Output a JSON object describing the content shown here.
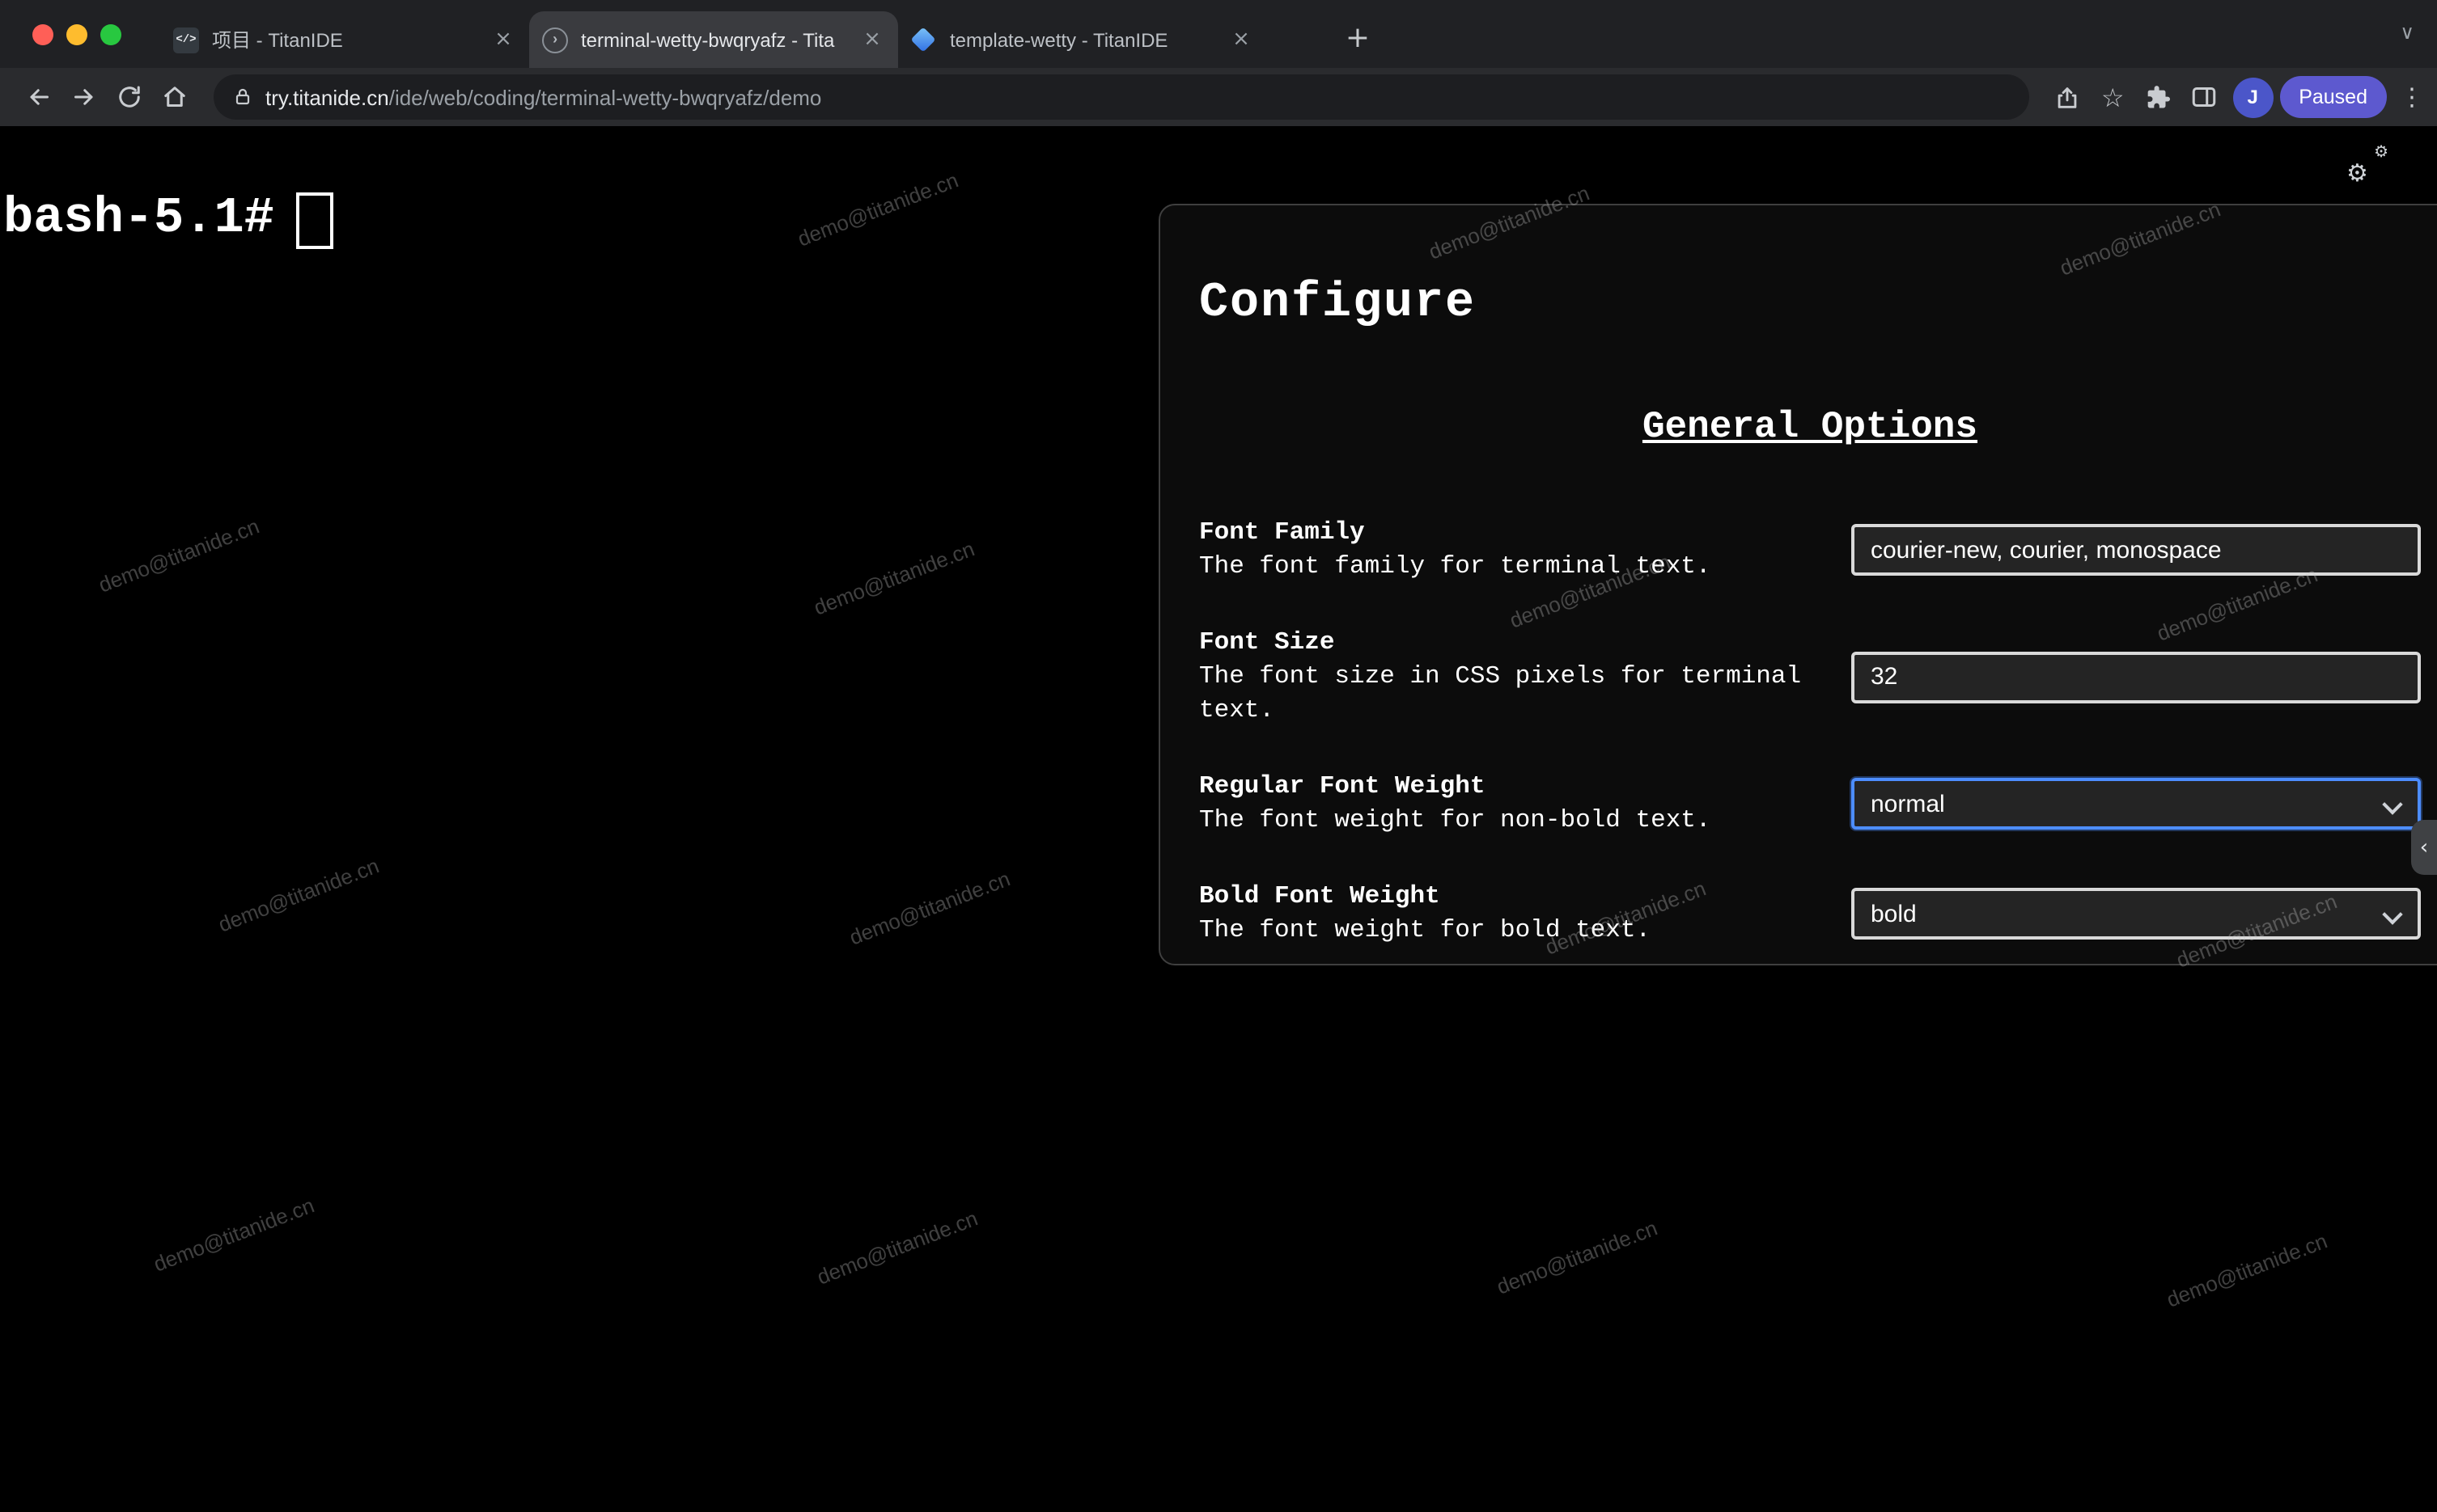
{
  "browser": {
    "tabs": [
      {
        "title": "项目 - TitanIDE",
        "icon_glyph": "</>"
      },
      {
        "title": "terminal-wetty-bwqryafz - Tita",
        "icon_glyph": "›"
      },
      {
        "title": "template-wetty - TitanIDE",
        "icon_glyph": ""
      }
    ],
    "url_host": "try.titanide.cn",
    "url_path": "/ide/web/coding/terminal-wetty-bwqryafz/demo",
    "profile_initial": "J",
    "profile_status": "Paused"
  },
  "icons": {
    "gear": "⚙",
    "star": "☆",
    "menu": "⋮",
    "close": "×",
    "new_tab": "+",
    "chevron_down": "∨",
    "collapse": "‹"
  },
  "terminal": {
    "prompt": "bash-5.1#"
  },
  "overlay": {
    "watermark": "demo@titanide.cn"
  },
  "configure": {
    "title": "Configure",
    "section_heading": "General Options",
    "fields": [
      {
        "label": "Font Family",
        "description": "The font family for terminal text.",
        "type": "input",
        "value": "courier-new, courier, monospace"
      },
      {
        "label": "Font Size",
        "description": "The font size in CSS pixels for terminal text.",
        "type": "input",
        "value": "32"
      },
      {
        "label": "Regular Font Weight",
        "description": "The font weight for non-bold text.",
        "type": "select",
        "value": "normal"
      },
      {
        "label": "Bold Font Weight",
        "description": "The font weight for bold text.",
        "type": "select",
        "value": "bold"
      }
    ]
  }
}
